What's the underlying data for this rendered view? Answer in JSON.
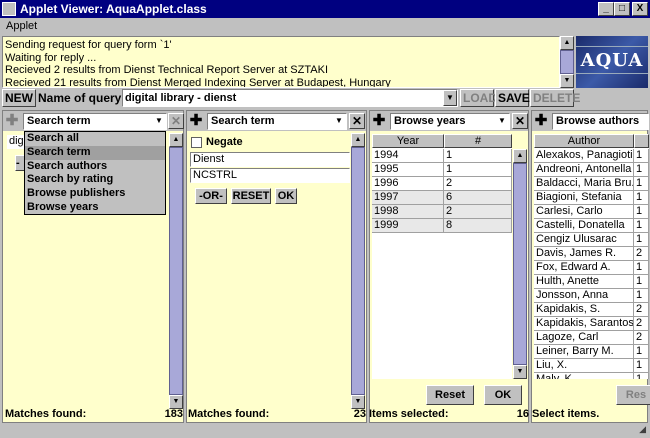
{
  "window": {
    "title": "Applet Viewer: AquaApplet.class",
    "min": "_",
    "max": "□",
    "close": "X"
  },
  "menu": {
    "applet": "Applet"
  },
  "log": [
    "Sending request for query form `1'",
    "Waiting for reply ...",
    "Recieved 2 results from Dienst Technical Report Server at SZTAKI",
    "Recieved 21 results from Dienst Merged Indexing Server at Budapest, Hungary"
  ],
  "logo": {
    "text": "AQUA"
  },
  "query": {
    "new_label": "NEW",
    "name_label": "Name of query:",
    "value": "digital library - dienst",
    "load_label": "LOAD",
    "save_label": "SAVE",
    "delete_label": "DELETE"
  },
  "panel1": {
    "select_value": "Search term",
    "under_text": "dig",
    "under_button": "-O",
    "status_label": "Matches found:",
    "status_count": "183",
    "popup_items": [
      "Search all",
      "Search term",
      "Search authors",
      "Search by rating",
      "Browse publishers",
      "Browse years"
    ],
    "popup_selected": 1
  },
  "panel2": {
    "select_value": "Search term",
    "negate_label": "Negate",
    "terms": [
      "Dienst",
      "NCSTRL"
    ],
    "or_label": "-OR-",
    "reset_label": "RESET",
    "ok_label": "OK",
    "status_label": "Matches found:",
    "status_count": "23"
  },
  "panel3": {
    "select_value": "Browse years",
    "col_year": "Year",
    "col_count": "#",
    "rows": [
      {
        "year": "1994",
        "count": "1"
      },
      {
        "year": "1995",
        "count": "1"
      },
      {
        "year": "1996",
        "count": "2"
      },
      {
        "year": "1997",
        "count": "6"
      },
      {
        "year": "1998",
        "count": "2"
      },
      {
        "year": "1999",
        "count": "8"
      }
    ],
    "reset_label": "Reset",
    "ok_label": "OK",
    "status_label": "Items selected:",
    "status_count": "16"
  },
  "panel4": {
    "select_value": "Browse authors",
    "col_author": "Author",
    "rows": [
      {
        "name": "Alexakos, Panagiotis",
        "count": "1"
      },
      {
        "name": "Andreoni, Antonella",
        "count": "1"
      },
      {
        "name": "Baldacci, Maria Bru...",
        "count": "1"
      },
      {
        "name": "Biagioni, Stefania",
        "count": "1"
      },
      {
        "name": "Carlesi, Carlo",
        "count": "1"
      },
      {
        "name": "Castelli, Donatella",
        "count": "1"
      },
      {
        "name": "Cengiz Ulusarac",
        "count": "1"
      },
      {
        "name": "Davis, James R.",
        "count": "2"
      },
      {
        "name": "Fox, Edward A.",
        "count": "1"
      },
      {
        "name": "Hulth, Anette",
        "count": "1"
      },
      {
        "name": "Jonsson, Anna",
        "count": "1"
      },
      {
        "name": "Kapidakis, S.",
        "count": "2"
      },
      {
        "name": "Kapidakis, Sarantos",
        "count": "2"
      },
      {
        "name": "Lagoze, Carl",
        "count": "2"
      },
      {
        "name": "Leiner, Barry M.",
        "count": "1"
      },
      {
        "name": "Liu, X.",
        "count": "1"
      },
      {
        "name": "Maly, K.",
        "count": "1"
      }
    ],
    "reset_label": "Res",
    "status_label": "Select items."
  }
}
